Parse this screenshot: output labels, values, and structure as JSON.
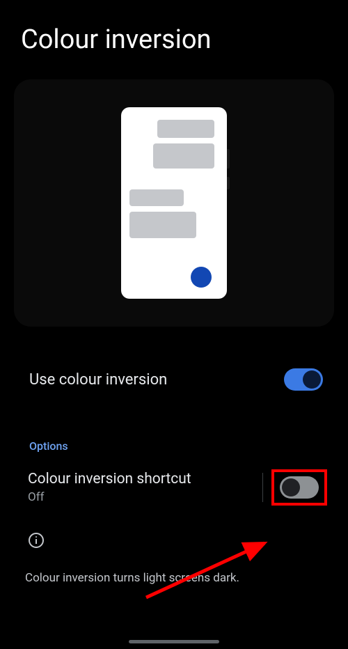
{
  "page": {
    "title": "Colour inversion"
  },
  "settings": {
    "use_inversion": {
      "label": "Use colour inversion",
      "enabled": true
    }
  },
  "options": {
    "header": "Options",
    "shortcut": {
      "title": "Colour inversion shortcut",
      "status": "Off",
      "enabled": false
    }
  },
  "description": "Colour inversion turns light screens dark."
}
